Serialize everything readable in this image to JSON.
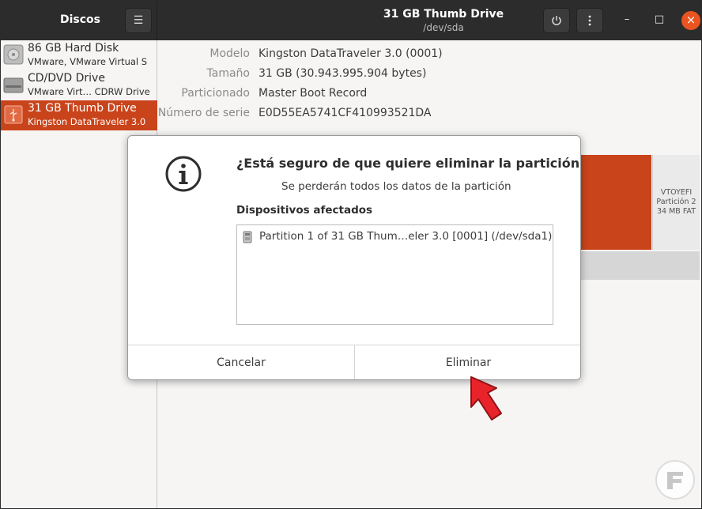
{
  "header": {
    "app_title": "Discos",
    "menu_icon": "hamburger-menu-icon",
    "title": "31 GB Thumb Drive",
    "subtitle": "/dev/sda",
    "power_icon": "power-icon",
    "more_icon": "vertical-dots-icon",
    "minimize_symbol": "–",
    "maximize_symbol": "□",
    "close_symbol": "×"
  },
  "sidebar": {
    "items": [
      {
        "name": "86 GB Hard Disk",
        "desc": "VMware, VMware Virtual S",
        "icon": "hard-disk-icon",
        "selected": false
      },
      {
        "name": "CD/DVD Drive",
        "desc": "VMware Virt… CDRW Drive",
        "icon": "optical-drive-icon",
        "selected": false
      },
      {
        "name": "31 GB Thumb Drive",
        "desc": "Kingston DataTraveler 3.0",
        "icon": "usb-drive-icon",
        "selected": true
      }
    ]
  },
  "details": {
    "rows": [
      {
        "key": "Modelo",
        "value": "Kingston DataTraveler 3.0 (0001)"
      },
      {
        "key": "Tamaño",
        "value": "31 GB (30.943.995.904 bytes)"
      },
      {
        "key": "Particionado",
        "value": "Master Boot Record"
      },
      {
        "key": "Número de serie",
        "value": "E0D55EA5741CF410993521DA"
      }
    ]
  },
  "volumes": {
    "partition2_line1": "VTOYEFI",
    "partition2_line2": "Partición 2",
    "partition2_line3": "34 MB FAT",
    "accent": "#c9441b"
  },
  "dialog": {
    "icon": "info-icon",
    "title": "¿Está seguro de que quiere eliminar la partición?",
    "message": "Se perderán todos los datos de la partición",
    "affected_label": "Dispositivos afectados",
    "affected_items": [
      {
        "icon": "usb-drive-icon",
        "text": "Partition 1 of 31 GB Thum…eler 3.0 [0001] (/dev/sda1)"
      }
    ],
    "cancel_label": "Cancelar",
    "delete_label": "Eliminar"
  },
  "colors": {
    "headerbar": "#2c2c2c",
    "selection": "#c9441b",
    "close_button": "#e95420",
    "pointer": "#e8242a"
  }
}
